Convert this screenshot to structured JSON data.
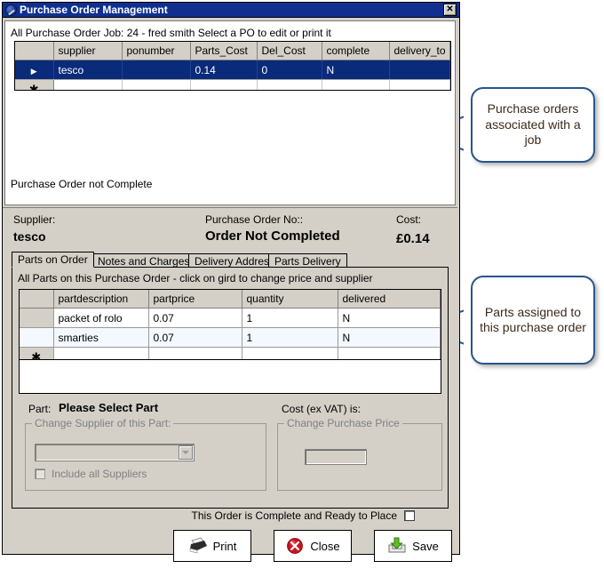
{
  "window": {
    "title": "Purchase Order Management",
    "icon": "app-disc-icon",
    "close_label": "✕"
  },
  "top_panel": {
    "caption": "All Purchase Order Job: 24 - fred smith Select a PO to edit or print it",
    "status": "Purchase Order not Complete",
    "grid": {
      "columns": [
        "supplier",
        "ponumber",
        "Parts_Cost",
        "Del_Cost",
        "complete",
        "delivery_to"
      ],
      "rows": [
        {
          "marker": "▶",
          "selected": true,
          "cells": [
            "tesco",
            "",
            "0.14",
            "0",
            "N",
            ""
          ]
        },
        {
          "marker": "✱",
          "selected": false,
          "cells": [
            "",
            "",
            "",
            "",
            "",
            ""
          ]
        }
      ]
    }
  },
  "summary": {
    "supplier_label": "Supplier:",
    "supplier_value": "tesco",
    "po_no_label": "Purchase Order No::",
    "po_no_value": "Order Not Completed",
    "cost_label": "Cost:",
    "cost_value": "£0.14"
  },
  "tabs": [
    {
      "label": "Parts on Order",
      "active": true
    },
    {
      "label": "Notes and Charges",
      "active": false
    },
    {
      "label": "Delivery Address",
      "active": false
    },
    {
      "label": "Parts Delivery",
      "active": false
    }
  ],
  "parts_tab": {
    "caption": "All Parts on this Purchase Order - click on gird to change price and supplier",
    "grid": {
      "columns": [
        "partdescription",
        "partprice",
        "quantity",
        "delivered"
      ],
      "rows": [
        {
          "marker": "",
          "alt": false,
          "cells": [
            "packet of rolo",
            "0.07",
            "1",
            "N"
          ]
        },
        {
          "marker": "",
          "alt": true,
          "cells": [
            "smarties",
            "0.07",
            "1",
            "N"
          ]
        },
        {
          "marker": "✱",
          "alt": false,
          "cells": [
            "",
            "",
            "",
            ""
          ]
        }
      ]
    },
    "part_label": "Part:",
    "part_value": "Please Select Part",
    "cost_label": "Cost (ex VAT) is:",
    "supplier_group_title": "Change Supplier of this Part:",
    "supplier_combo_value": "",
    "include_all_suppliers_label": "Include all Suppliers",
    "price_group_title": "Change Purchase Price",
    "price_value": ""
  },
  "footer": {
    "complete_label": "This Order is Complete and Ready to Place",
    "complete_checked": false,
    "buttons": [
      {
        "label": "Print",
        "icon": "printer-icon"
      },
      {
        "label": "Close",
        "icon": "red-x-circle-icon"
      },
      {
        "label": "Save",
        "icon": "save-download-icon"
      }
    ]
  },
  "callouts": [
    {
      "text": "Purchase orders associated with a job"
    },
    {
      "text": "Parts assigned to this purchase order"
    }
  ],
  "colors": {
    "titlebar": "#103090",
    "selection": "#0a2a7a",
    "dialog_face": "#d4d0c8",
    "callout_border": "#27558c",
    "callout_text": "#3c2a1a"
  }
}
